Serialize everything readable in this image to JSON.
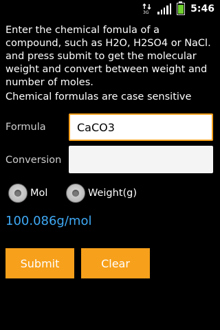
{
  "status_bar": {
    "time": "5:46",
    "icons": [
      "data-3g-icon",
      "signal-icon",
      "battery-icon"
    ]
  },
  "intro_text": "Enter the chemical fomula of a compound, such as H2O, H2SO4 or NaCl. and press submit to get the molecular weight and convert between weight and number of moles.",
  "note_text": "Chemical formulas are case sensitive",
  "formula": {
    "label": "Formula",
    "value": "CaCO3"
  },
  "conversion": {
    "label": "Conversion",
    "value": ""
  },
  "radios": [
    {
      "label": "Mol",
      "selected": false
    },
    {
      "label": "Weight(g)",
      "selected": false
    }
  ],
  "result": "100.086g/mol",
  "buttons": {
    "submit": "Submit",
    "clear": "Clear"
  },
  "colors": {
    "accent": "#f7a01b",
    "result": "#3fa9f5",
    "background": "#000000"
  }
}
